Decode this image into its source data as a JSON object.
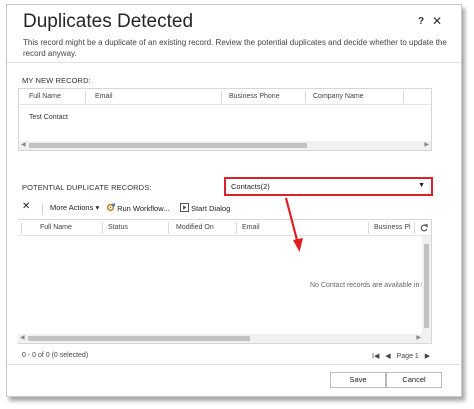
{
  "dialog": {
    "title": "Duplicates Detected",
    "help_label": "?",
    "close_label": "✕",
    "description": "This record might be a duplicate of an existing record. Review the potential duplicates and decide whether to update the record anyway."
  },
  "new_record": {
    "section_label": "MY NEW RECORD:",
    "columns": [
      "Full Name",
      "Email",
      "Business Phone",
      "Company Name"
    ],
    "rows": [
      [
        "Test Contact",
        "",
        "",
        ""
      ]
    ]
  },
  "potential": {
    "section_label": "POTENTIAL DUPLICATE RECORDS:",
    "dropdown_value": "Contacts(2)",
    "dropdown_caret": "▼",
    "toolbar": {
      "delete_icon": "✕",
      "more_actions": "More Actions",
      "more_actions_caret": "▾",
      "run_workflow": "Run Workflow...",
      "start_dialog": "Start Dialog"
    },
    "columns": [
      "Full Name",
      "Status",
      "Modified On",
      "Email",
      "Business Pl"
    ],
    "empty_message": "No Contact records are available in th",
    "status_text": "0 - 0 of 0 (0 selected)",
    "pager": {
      "first": "I◀",
      "prev": "◀",
      "page_label": "Page 1",
      "next": "▶"
    }
  },
  "buttons": {
    "save": "Save",
    "cancel": "Cancel"
  },
  "colors": {
    "highlight": "#d9232a",
    "arrow": "#e02020"
  }
}
